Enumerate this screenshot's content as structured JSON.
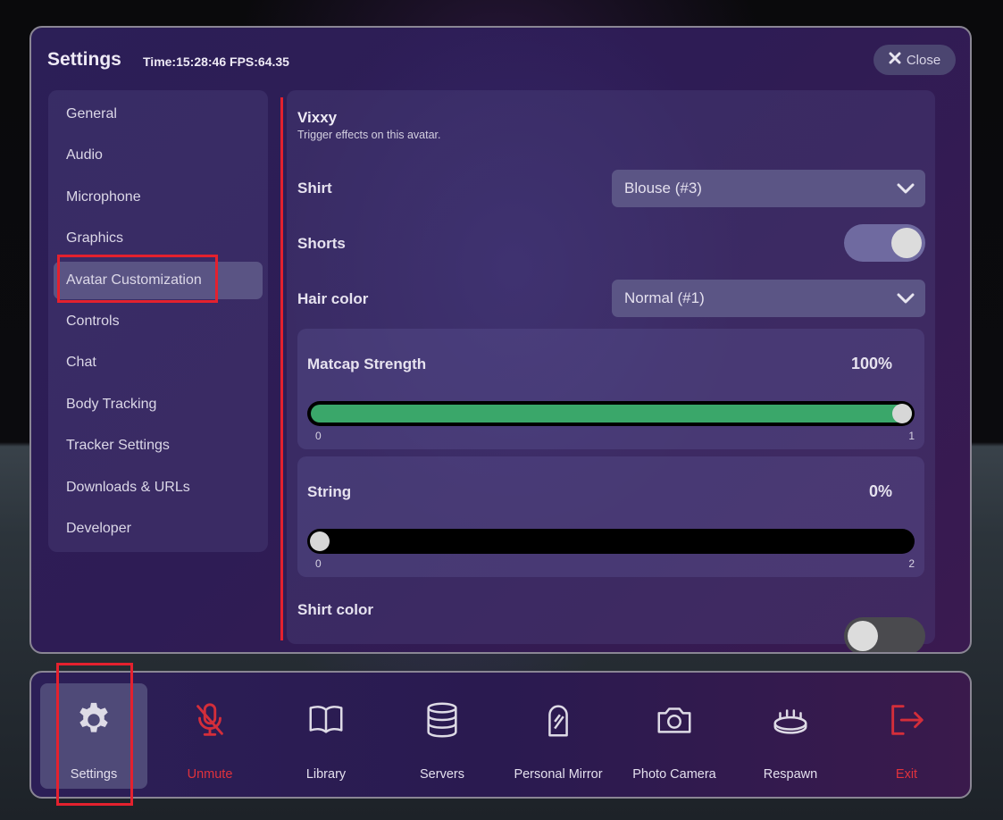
{
  "settings": {
    "title": "Settings",
    "stats": "Time:15:28:46 FPS:64.35",
    "close_label": "Close"
  },
  "sidebar": {
    "items": [
      {
        "label": "General"
      },
      {
        "label": "Audio"
      },
      {
        "label": "Microphone"
      },
      {
        "label": "Graphics"
      },
      {
        "label": "Avatar Customization",
        "active": true
      },
      {
        "label": "Controls"
      },
      {
        "label": "Chat"
      },
      {
        "label": "Body Tracking"
      },
      {
        "label": "Tracker Settings"
      },
      {
        "label": "Downloads & URLs"
      },
      {
        "label": "Developer"
      }
    ]
  },
  "content": {
    "avatar_name": "Vixxy",
    "avatar_desc": "Trigger effects on this avatar.",
    "shirt": {
      "label": "Shirt",
      "value": "Blouse (#3)"
    },
    "shorts": {
      "label": "Shorts",
      "on": true
    },
    "hair_color": {
      "label": "Hair color",
      "value": "Normal (#1)"
    },
    "matcap": {
      "label": "Matcap Strength",
      "value_text": "100%",
      "min": "0",
      "max": "1",
      "value": 1.0
    },
    "string": {
      "label": "String",
      "value_text": "0%",
      "min": "0",
      "max": "2",
      "value": 0.0
    },
    "shirt_color": {
      "label": "Shirt color",
      "on": false
    }
  },
  "taskbar": {
    "items": [
      {
        "label": "Settings",
        "icon": "gear-icon",
        "active": true
      },
      {
        "label": "Unmute",
        "icon": "microphone-muted-icon",
        "color": "#e0323c"
      },
      {
        "label": "Library",
        "icon": "book-icon"
      },
      {
        "label": "Servers",
        "icon": "database-icon"
      },
      {
        "label": "Personal Mirror",
        "icon": "mirror-icon"
      },
      {
        "label": "Photo Camera",
        "icon": "camera-icon"
      },
      {
        "label": "Respawn",
        "icon": "respawn-icon"
      },
      {
        "label": "Exit",
        "icon": "exit-icon",
        "color": "#e0323c"
      }
    ]
  },
  "colors": {
    "accent_red": "#e4212e",
    "slider_fill": "#3aa76a",
    "active_item": "#5a5484"
  }
}
